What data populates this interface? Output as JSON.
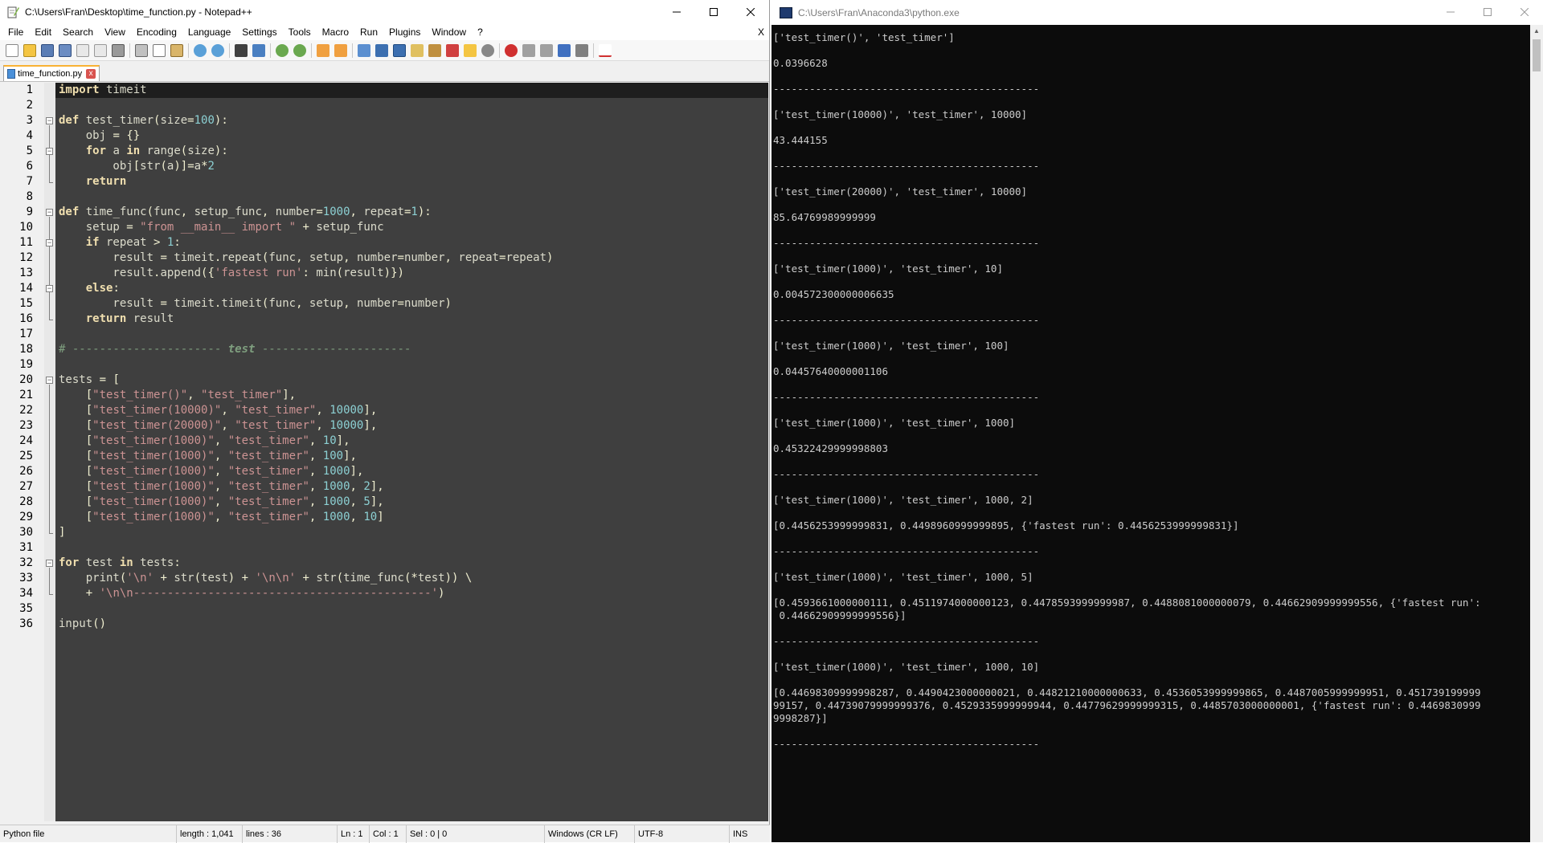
{
  "npp": {
    "title": "C:\\Users\\Fran\\Desktop\\time_function.py - Notepad++",
    "menu": [
      "File",
      "Edit",
      "Search",
      "View",
      "Encoding",
      "Language",
      "Settings",
      "Tools",
      "Macro",
      "Run",
      "Plugins",
      "Window",
      "?"
    ],
    "menu_close_doc": "X",
    "tab_label": "time_function.py",
    "tab_close": "x",
    "code_lines": [
      "import timeit",
      "",
      "def test_timer(size=100):",
      "    obj = {}",
      "    for a in range(size):",
      "        obj[str(a)]=a*2",
      "    return",
      "",
      "def time_func(func, setup_func, number=1000, repeat=1):",
      "    setup = \"from __main__ import \" + setup_func",
      "    if repeat > 1:",
      "        result = timeit.repeat(func, setup, number=number, repeat=repeat)",
      "        result.append({'fastest run': min(result)})",
      "    else:",
      "        result = timeit.timeit(func, setup, number=number)",
      "    return result",
      "",
      "# ---------------------- test ----------------------",
      "",
      "tests = [",
      "    [\"test_timer()\", \"test_timer\"],",
      "    [\"test_timer(10000)\", \"test_timer\", 10000],",
      "    [\"test_timer(20000)\", \"test_timer\", 10000],",
      "    [\"test_timer(1000)\", \"test_timer\", 10],",
      "    [\"test_timer(1000)\", \"test_timer\", 100],",
      "    [\"test_timer(1000)\", \"test_timer\", 1000],",
      "    [\"test_timer(1000)\", \"test_timer\", 1000, 2],",
      "    [\"test_timer(1000)\", \"test_timer\", 1000, 5],",
      "    [\"test_timer(1000)\", \"test_timer\", 1000, 10]",
      "]",
      "",
      "for test in tests:",
      "    print('\\n' + str(test) + '\\n\\n' + str(time_func(*test)) \\",
      "    + '\\n\\n--------------------------------------------')",
      "",
      "input()"
    ],
    "status": {
      "file_type": "Python file",
      "length": "length : 1,041",
      "lines": "lines : 36",
      "ln": "Ln : 1",
      "col": "Col : 1",
      "sel": "Sel : 0 | 0",
      "eol": "Windows (CR LF)",
      "encoding": "UTF-8",
      "mode": "INS"
    }
  },
  "console": {
    "title": "C:\\Users\\Fran\\Anaconda3\\python.exe",
    "output": [
      "['test_timer()', 'test_timer']",
      "",
      "0.0396628",
      "",
      "--------------------------------------------",
      "",
      "['test_timer(10000)', 'test_timer', 10000]",
      "",
      "43.444155",
      "",
      "--------------------------------------------",
      "",
      "['test_timer(20000)', 'test_timer', 10000]",
      "",
      "85.64769989999999",
      "",
      "--------------------------------------------",
      "",
      "['test_timer(1000)', 'test_timer', 10]",
      "",
      "0.004572300000006635",
      "",
      "--------------------------------------------",
      "",
      "['test_timer(1000)', 'test_timer', 100]",
      "",
      "0.04457640000001106",
      "",
      "--------------------------------------------",
      "",
      "['test_timer(1000)', 'test_timer', 1000]",
      "",
      "0.45322429999998803",
      "",
      "--------------------------------------------",
      "",
      "['test_timer(1000)', 'test_timer', 1000, 2]",
      "",
      "[0.4456253999999831, 0.4498960999999895, {'fastest run': 0.4456253999999831}]",
      "",
      "--------------------------------------------",
      "",
      "['test_timer(1000)', 'test_timer', 1000, 5]",
      "",
      "[0.4593661000000111, 0.4511974000000123, 0.4478593999999987, 0.4488081000000079, 0.44662909999999556, {'fastest run':",
      " 0.44662909999999556}]",
      "",
      "--------------------------------------------",
      "",
      "['test_timer(1000)', 'test_timer', 1000, 10]",
      "",
      "[0.44698309999998287, 0.4490423000000021, 0.44821210000000633, 0.4536053999999865, 0.4487005999999951, 0.451739199999",
      "99157, 0.44739079999999376, 0.4529335999999944, 0.44779629999999315, 0.4485703000000001, {'fastest run': 0.4469830999",
      "9998287}]",
      "",
      "--------------------------------------------"
    ]
  }
}
